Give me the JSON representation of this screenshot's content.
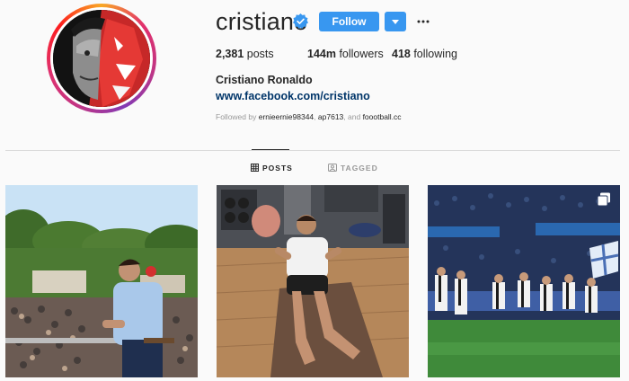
{
  "profile": {
    "username": "cristiano",
    "verified_icon": "verified-badge-icon",
    "follow_label": "Follow",
    "posts_count": "2,381",
    "posts_label": " posts",
    "followers_count": "144m",
    "followers_label": " followers",
    "following_count": "418",
    "following_label": " following",
    "full_name": "Cristiano Ronaldo",
    "website": "www.facebook.com/cristiano",
    "followed_by_prefix": "Followed by ",
    "followed_by_accounts": [
      "ernieernie98344",
      "ap7613",
      "foootball.cc"
    ],
    "followed_sep1": ", ",
    "followed_sep2": ", and "
  },
  "tabs": [
    {
      "label": "POSTS",
      "active": true,
      "icon": "grid-icon"
    },
    {
      "label": "TAGGED",
      "active": false,
      "icon": "tagged-icon"
    }
  ],
  "colors": {
    "accent": "#3897f0",
    "link": "#003569",
    "muted": "#999999"
  }
}
